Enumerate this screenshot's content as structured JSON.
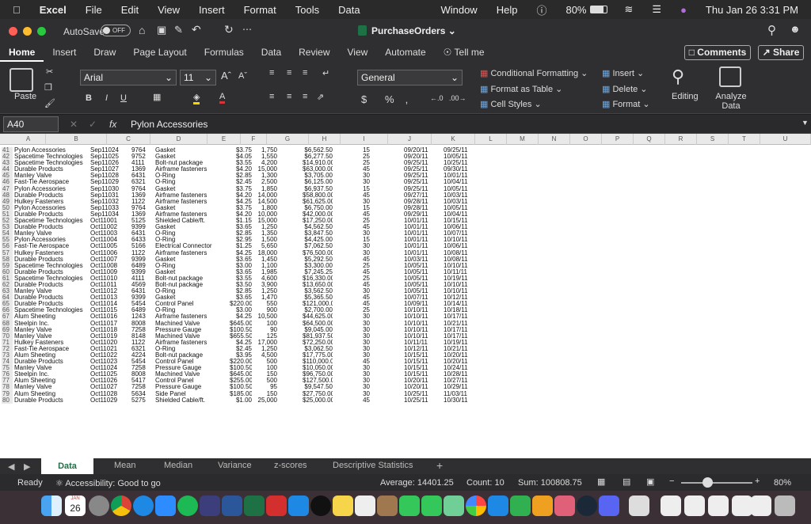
{
  "menubar": {
    "app": "Excel",
    "items": [
      "File",
      "Edit",
      "View",
      "Insert",
      "Format",
      "Tools",
      "Data"
    ],
    "window": "Window",
    "help": "Help",
    "battery": "80%",
    "datetime": "Thu Jan 26  3:31 PM"
  },
  "titlebar": {
    "autosave": "AutoSave",
    "autosave_state": "OFF",
    "filename": "PurchaseOrders"
  },
  "ribbon_tabs": [
    "Home",
    "Insert",
    "Draw",
    "Page Layout",
    "Formulas",
    "Data",
    "Review",
    "View",
    "Automate"
  ],
  "tell_me": "Tell me",
  "comments": "Comments",
  "share": "Share",
  "ribbon": {
    "paste": "Paste",
    "font_name": "Arial",
    "font_size": "11",
    "number_format": "General",
    "conditional": "Conditional Formatting",
    "format_table": "Format as Table",
    "cell_styles": "Cell Styles",
    "insert": "Insert",
    "delete": "Delete",
    "format": "Format",
    "editing": "Editing",
    "analyze": "Analyze Data"
  },
  "formula_bar": {
    "name_box": "A40",
    "fx": "fx",
    "value": "Pylon Accessories"
  },
  "columns": [
    "A",
    "B",
    "C",
    "D",
    "E",
    "F",
    "G",
    "H",
    "I",
    "J",
    "K",
    "L",
    "M",
    "N",
    "O",
    "P",
    "Q",
    "R",
    "S",
    "T",
    "U"
  ],
  "rows": [
    [
      "41",
      "Pylon Accessories",
      "Sep11024",
      "9764",
      "Gasket",
      "$3.75",
      "1,750",
      "$6,562.50",
      "15",
      "09/20/11",
      "09/25/11"
    ],
    [
      "42",
      "Spacetime Technologies",
      "Sep11025",
      "9752",
      "Gasket",
      "$4.05",
      "1,550",
      "$6,277.50",
      "25",
      "09/20/11",
      "10/05/11"
    ],
    [
      "43",
      "Spacetime Technologies",
      "Sep11026",
      "4111",
      "Bolt-nut package",
      "$3.55",
      "4,200",
      "$14,910.00",
      "25",
      "09/25/11",
      "10/25/11"
    ],
    [
      "44",
      "Durable Products",
      "Sep11027",
      "1369",
      "Airframe fasteners",
      "$4.20",
      "15,000",
      "$63,000.00",
      "45",
      "09/25/11",
      "09/30/11"
    ],
    [
      "45",
      "Manley Valve",
      "Sep11028",
      "6431",
      "O-Ring",
      "$2.85",
      "1,300",
      "$3,705.00",
      "30",
      "09/25/11",
      "10/01/11"
    ],
    [
      "46",
      "Fast-Tie Aerospace",
      "Sep11029",
      "6321",
      "O-Ring",
      "$2.45",
      "2,500",
      "$6,125.00",
      "30",
      "09/25/11",
      "10/04/11"
    ],
    [
      "47",
      "Pylon Accessories",
      "Sep11030",
      "9764",
      "Gasket",
      "$3.75",
      "1,850",
      "$6,937.50",
      "15",
      "09/25/11",
      "10/05/11"
    ],
    [
      "48",
      "Durable Products",
      "Sep11031",
      "1369",
      "Airframe fasteners",
      "$4.20",
      "14,000",
      "$58,800.00",
      "45",
      "09/27/11",
      "10/03/11"
    ],
    [
      "49",
      "Hulkey Fasteners",
      "Sep11032",
      "1122",
      "Airframe fasteners",
      "$4.25",
      "14,500",
      "$61,625.00",
      "30",
      "09/28/11",
      "10/03/11"
    ],
    [
      "50",
      "Pylon Accessories",
      "Sep11033",
      "9764",
      "Gasket",
      "$3.75",
      "1,800",
      "$6,750.00",
      "15",
      "09/28/11",
      "10/05/11"
    ],
    [
      "51",
      "Durable Products",
      "Sep11034",
      "1369",
      "Airframe fasteners",
      "$4.20",
      "10,000",
      "$42,000.00",
      "45",
      "09/29/11",
      "10/04/11"
    ],
    [
      "52",
      "Spacetime Technologies",
      "Oct11001",
      "5125",
      "Shielded Cable/ft.",
      "$1.15",
      "15,000",
      "$17,250.00",
      "25",
      "10/01/11",
      "10/15/11"
    ],
    [
      "53",
      "Durable Products",
      "Oct11002",
      "9399",
      "Gasket",
      "$3.65",
      "1,250",
      "$4,562.50",
      "45",
      "10/01/11",
      "10/06/11"
    ],
    [
      "54",
      "Manley Valve",
      "Oct11003",
      "6431",
      "O-Ring",
      "$2.85",
      "1,350",
      "$3,847.50",
      "30",
      "10/01/11",
      "10/07/11"
    ],
    [
      "55",
      "Pylon Accessories",
      "Oct11004",
      "6433",
      "O-Ring",
      "$2.95",
      "1,500",
      "$4,425.00",
      "15",
      "10/01/11",
      "10/10/11"
    ],
    [
      "56",
      "Fast-Tie Aerospace",
      "Oct11005",
      "5166",
      "Electrical Connector",
      "$1.25",
      "5,650",
      "$7,062.50",
      "30",
      "10/01/11",
      "10/06/11"
    ],
    [
      "57",
      "Hulkey Fasteners",
      "Oct11006",
      "1122",
      "Airframe fasteners",
      "$4.25",
      "18,000",
      "$76,500.00",
      "30",
      "10/01/11",
      "10/08/11"
    ],
    [
      "58",
      "Durable Products",
      "Oct11007",
      "9399",
      "Gasket",
      "$3.65",
      "1,450",
      "$5,292.50",
      "45",
      "10/03/11",
      "10/08/11"
    ],
    [
      "59",
      "Spacetime Technologies",
      "Oct11008",
      "6489",
      "O-Ring",
      "$3.00",
      "1,100",
      "$3,300.00",
      "25",
      "10/05/11",
      "10/10/11"
    ],
    [
      "60",
      "Durable Products",
      "Oct11009",
      "9399",
      "Gasket",
      "$3.65",
      "1,985",
      "$7,245.25",
      "45",
      "10/05/11",
      "10/11/11"
    ],
    [
      "61",
      "Spacetime Technologies",
      "Oct11010",
      "4111",
      "Bolt-nut package",
      "$3.55",
      "4,600",
      "$16,330.00",
      "25",
      "10/05/11",
      "10/19/11"
    ],
    [
      "62",
      "Durable Products",
      "Oct11011",
      "4569",
      "Bolt-nut package",
      "$3.50",
      "3,900",
      "$13,650.00",
      "45",
      "10/05/11",
      "10/10/11"
    ],
    [
      "63",
      "Manley Valve",
      "Oct11012",
      "6431",
      "O-Ring",
      "$2.85",
      "1,250",
      "$3,562.50",
      "30",
      "10/05/11",
      "10/10/11"
    ],
    [
      "64",
      "Durable Products",
      "Oct11013",
      "9399",
      "Gasket",
      "$3.65",
      "1,470",
      "$5,365.50",
      "45",
      "10/07/11",
      "10/12/11"
    ],
    [
      "65",
      "Durable Products",
      "Oct11014",
      "5454",
      "Control Panel",
      "$220.00",
      "550",
      "$121,000.00",
      "45",
      "10/09/11",
      "10/14/11"
    ],
    [
      "66",
      "Spacetime Technologies",
      "Oct11015",
      "6489",
      "O-Ring",
      "$3.00",
      "900",
      "$2,700.00",
      "25",
      "10/10/11",
      "10/18/11"
    ],
    [
      "67",
      "Alum Sheeting",
      "Oct11016",
      "1243",
      "Airframe fasteners",
      "$4.25",
      "10,500",
      "$44,625.00",
      "30",
      "10/10/11",
      "10/17/11"
    ],
    [
      "68",
      "Steelpin Inc.",
      "Oct11017",
      "8008",
      "Machined Valve",
      "$645.00",
      "100",
      "$64,500.00",
      "30",
      "10/10/11",
      "10/21/11"
    ],
    [
      "69",
      "Manley Valve",
      "Oct11018",
      "7258",
      "Pressure Gauge",
      "$100.50",
      "90",
      "$9,045.00",
      "30",
      "10/10/11",
      "10/17/11"
    ],
    [
      "70",
      "Manley Valve",
      "Oct11019",
      "8148",
      "Machined Valve",
      "$655.50",
      "125",
      "$81,937.50",
      "30",
      "10/10/11",
      "10/17/11"
    ],
    [
      "71",
      "Hulkey Fasteners",
      "Oct11020",
      "1122",
      "Airframe fasteners",
      "$4.25",
      "17,000",
      "$72,250.00",
      "30",
      "10/11/11",
      "10/19/11"
    ],
    [
      "72",
      "Fast-Tie Aerospace",
      "Oct11021",
      "6321",
      "O-Ring",
      "$2.45",
      "1,250",
      "$3,062.50",
      "30",
      "10/12/11",
      "10/21/11"
    ],
    [
      "73",
      "Alum Sheeting",
      "Oct11022",
      "4224",
      "Bolt-nut package",
      "$3.95",
      "4,500",
      "$17,775.00",
      "30",
      "10/15/11",
      "10/20/11"
    ],
    [
      "74",
      "Durable Products",
      "Oct11023",
      "5454",
      "Control Panel",
      "$220.00",
      "500",
      "$110,000.00",
      "45",
      "10/15/11",
      "10/20/11"
    ],
    [
      "75",
      "Manley Valve",
      "Oct11024",
      "7258",
      "Pressure Gauge",
      "$100.50",
      "100",
      "$10,050.00",
      "30",
      "10/15/11",
      "10/24/11"
    ],
    [
      "76",
      "Steelpin Inc.",
      "Oct11025",
      "8008",
      "Machined Valve",
      "$645.00",
      "150",
      "$96,750.00",
      "30",
      "10/15/11",
      "10/28/11"
    ],
    [
      "77",
      "Alum Sheeting",
      "Oct11026",
      "5417",
      "Control Panel",
      "$255.00",
      "500",
      "$127,500.00",
      "30",
      "10/20/11",
      "10/27/11"
    ],
    [
      "78",
      "Manley Valve",
      "Oct11027",
      "7258",
      "Pressure Gauge",
      "$100.50",
      "95",
      "$9,547.50",
      "30",
      "10/20/11",
      "10/29/11"
    ],
    [
      "79",
      "Alum Sheeting",
      "Oct11028",
      "5634",
      "Side Panel",
      "$185.00",
      "150",
      "$27,750.00",
      "30",
      "10/25/11",
      "11/03/11"
    ],
    [
      "80",
      "Durable Products",
      "Oct11029",
      "5275",
      "Shielded Cable/ft.",
      "$1.00",
      "25,000",
      "$25,000.00",
      "45",
      "10/25/11",
      "10/30/11"
    ]
  ],
  "sheet_tabs": [
    "Data",
    "Mean",
    "Median",
    "Variance",
    "z-scores",
    "Descriptive Statistics"
  ],
  "status": {
    "ready": "Ready",
    "accessibility": "Accessibility: Good to go",
    "average": "Average: 14401.25",
    "count": "Count: 10",
    "sum": "Sum: 100808.75",
    "zoom": "80%"
  },
  "dock": {
    "calendar_day": "26",
    "calendar_month": "JAN"
  }
}
